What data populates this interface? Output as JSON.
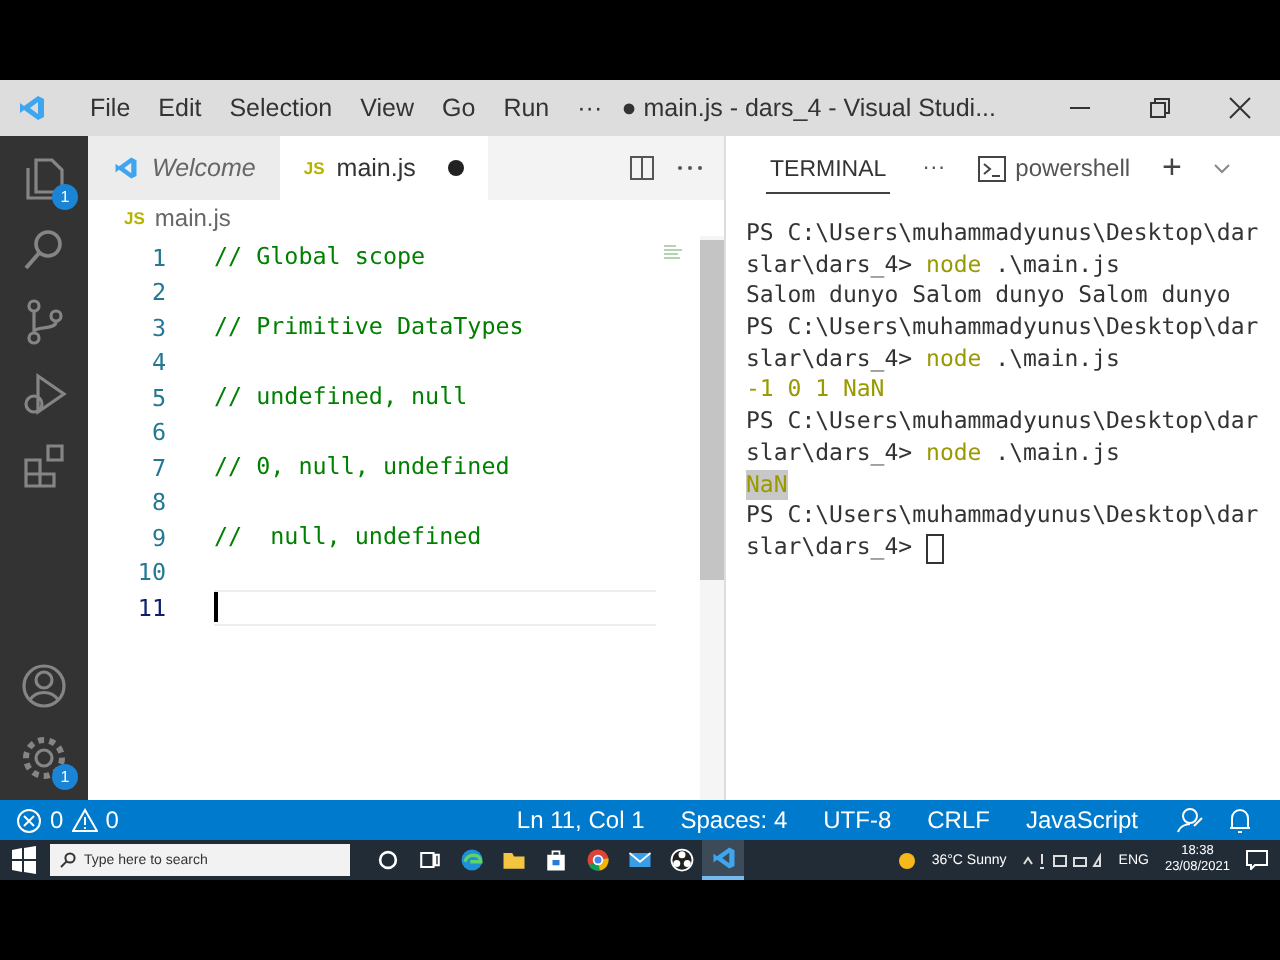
{
  "window": {
    "title": "● main.js - dars_4 - Visual Studi..."
  },
  "menu": [
    "File",
    "Edit",
    "Selection",
    "View",
    "Go",
    "Run",
    "···"
  ],
  "activity_bar": [
    {
      "kind": "explorer",
      "badge": "1"
    },
    {
      "kind": "search"
    },
    {
      "kind": "source-control"
    },
    {
      "kind": "debug"
    },
    {
      "kind": "extensions"
    },
    {
      "kind": "account"
    },
    {
      "kind": "settings",
      "badge": "1"
    }
  ],
  "tabs": [
    {
      "label": "Welcome",
      "kind": "preview",
      "selected": false,
      "dirty": false
    },
    {
      "label": "main.js",
      "icon_label": "JS",
      "kind": "file",
      "selected": true,
      "dirty": true
    }
  ],
  "breadcrumb": {
    "icon_label": "JS",
    "label": "main.js"
  },
  "editor": {
    "lines": [
      {
        "number": "1",
        "code": "// Global scope",
        "current": false
      },
      {
        "number": "2",
        "current": false
      },
      {
        "number": "3",
        "code": "// Primitive DataTypes",
        "current": false
      },
      {
        "number": "4",
        "current": false
      },
      {
        "number": "5",
        "code": "// undefined, null",
        "current": false
      },
      {
        "number": "6",
        "current": false
      },
      {
        "number": "7",
        "code": "// 0, null, undefined",
        "current": false
      },
      {
        "number": "8",
        "current": false
      },
      {
        "number": "9",
        "code": "//  null, undefined",
        "current": false
      },
      {
        "number": "10",
        "current": false
      },
      {
        "number": "11",
        "current": true
      }
    ]
  },
  "terminal": {
    "tab": "TERMINAL",
    "more": "···",
    "shell": "powershell",
    "new": "+",
    "lines": [
      [
        {
          "text": "PS C:\\Users\\muhammadyunus\\Desktop\\dar",
          "kind": "plain"
        }
      ],
      [
        {
          "text": "slar\\dars_4> ",
          "kind": "plain"
        },
        {
          "text": "node",
          "kind": "command"
        },
        {
          "text": " .\\main.js",
          "kind": "plain"
        }
      ],
      [
        {
          "text": "Salom dunyo Salom dunyo Salom dunyo",
          "kind": "plain"
        }
      ],
      [
        {
          "text": "PS C:\\Users\\muhammadyunus\\Desktop\\dar",
          "kind": "plain"
        }
      ],
      [
        {
          "text": "slar\\dars_4> ",
          "kind": "plain"
        },
        {
          "text": "node",
          "kind": "command"
        },
        {
          "text": " .\\main.js",
          "kind": "plain"
        }
      ],
      [
        {
          "text": "-1 0 1 NaN",
          "kind": "number"
        }
      ],
      [
        {
          "text": "PS C:\\Users\\muhammadyunus\\Desktop\\dar",
          "kind": "plain"
        }
      ],
      [
        {
          "text": "slar\\dars_4> ",
          "kind": "plain"
        },
        {
          "text": "node",
          "kind": "command"
        },
        {
          "text": " .\\main.js",
          "kind": "plain"
        }
      ],
      [
        {
          "text": "NaN",
          "kind": "selected"
        }
      ],
      [
        {
          "text": "PS C:\\Users\\muhammadyunus\\Desktop\\dar",
          "kind": "plain"
        }
      ],
      [
        {
          "text": "slar\\dars_4> ",
          "kind": "plain"
        },
        {
          "kind": "cursor"
        }
      ]
    ]
  },
  "status_bar": {
    "errors": "0",
    "warnings": "0",
    "items": [
      "Ln 11, Col 1",
      "Spaces: 4",
      "UTF-8",
      "CRLF",
      "JavaScript"
    ]
  },
  "taskbar": {
    "search_placeholder": "Type here to search",
    "apps": [
      {
        "kind": "cortana",
        "selected": false
      },
      {
        "kind": "task-view",
        "selected": false
      },
      {
        "kind": "edge",
        "selected": false
      },
      {
        "kind": "files",
        "selected": false
      },
      {
        "kind": "store",
        "selected": false
      },
      {
        "kind": "chrome",
        "selected": false
      },
      {
        "kind": "mail",
        "selected": false
      },
      {
        "kind": "obs",
        "selected": false
      },
      {
        "kind": "vscode",
        "selected": true
      }
    ],
    "weather": "36°C  Sunny",
    "language": "ENG",
    "time": "18:38",
    "date": "23/08/2021"
  }
}
